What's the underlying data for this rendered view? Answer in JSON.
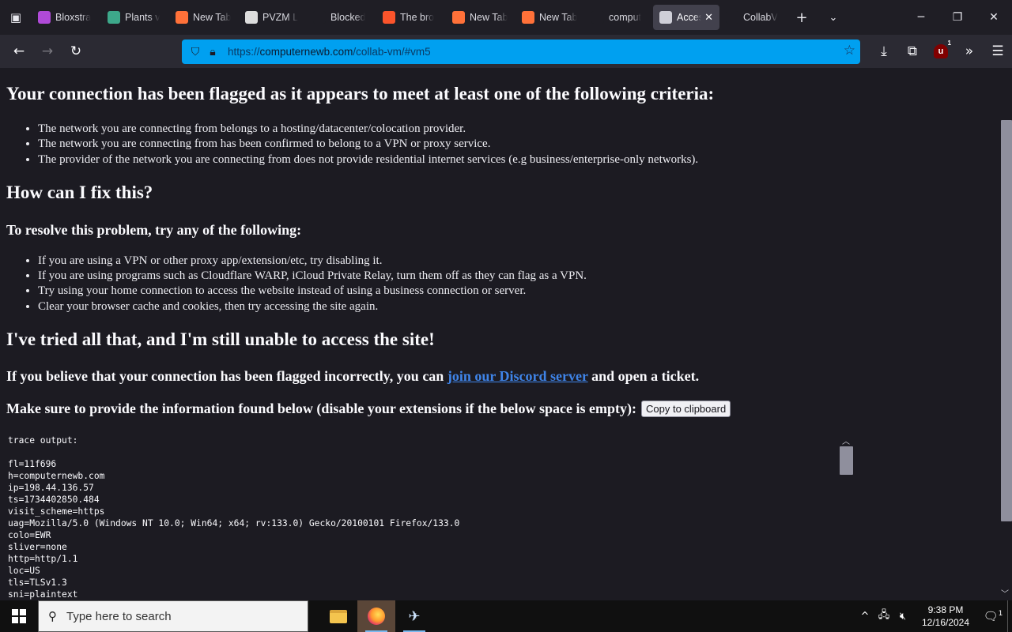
{
  "browser": {
    "tabs": [
      {
        "label": "Bloxstra",
        "icon": "bloxstrap-icon",
        "color": "#b04ad8"
      },
      {
        "label": "Plants v",
        "icon": "plants-icon",
        "color": "#3da88a"
      },
      {
        "label": "New Tab",
        "icon": "firefox-icon",
        "color": "#ff7139"
      },
      {
        "label": "PVZM L",
        "icon": "pvzm-icon",
        "color": "#dddddd"
      },
      {
        "label": "Blocked",
        "icon": "blank-icon",
        "color": "#1f1e25"
      },
      {
        "label": "The bro",
        "icon": "brave-icon",
        "color": "#fb542b"
      },
      {
        "label": "New Tab",
        "icon": "firefox-icon",
        "color": "#ff7139"
      },
      {
        "label": "New Tab",
        "icon": "firefox-icon",
        "color": "#ff7139"
      },
      {
        "label": "comput",
        "icon": "r-icon",
        "color": "#1f1e25"
      },
      {
        "label": "Acces",
        "icon": "collab-icon",
        "color": "#cfcfd8"
      },
      {
        "label": "CollabV",
        "icon": "search-icon",
        "color": "#1f1e25"
      }
    ],
    "url": {
      "scheme": "https://",
      "host": "computernewb.com",
      "path": "/collab-vm/#vm5"
    },
    "ublock_count": "1"
  },
  "page": {
    "headline": "Your connection has been flagged as it appears to meet at least one of the following criteria:",
    "criteria": [
      "The network you are connecting from belongs to a hosting/datacenter/colocation provider.",
      "The network you are connecting from has been confirmed to belong to a VPN or proxy service.",
      "The provider of the network you are connecting from does not provide residential internet services (e.g business/enterprise-only networks)."
    ],
    "fix_heading": "How can I fix this?",
    "resolve_heading": "To resolve this problem, try any of the following:",
    "fixes": [
      "If you are using a VPN or other proxy app/extension/etc, try disabling it.",
      "If you are using programs such as Cloudflare WARP, iCloud Private Relay, turn them off as they can flag as a VPN.",
      "Try using your home connection to access the website instead of using a business connection or server.",
      "Clear your browser cache and cookies, then try accessing the site again."
    ],
    "tried_heading": "I've tried all that, and I'm still unable to access the site!",
    "discord_before": "If you believe that your connection has been flagged incorrectly, you can ",
    "discord_link": "join our Discord server",
    "discord_after": " and open a ticket.",
    "provide_text": "Make sure to provide the information found below (disable your extensions if the below space is empty):",
    "copy_button": "Copy to clipboard",
    "trace_lines": [
      "trace output:",
      "",
      "fl=11f696",
      "h=computernewb.com",
      "ip=198.44.136.57",
      "ts=1734402850.484",
      "visit_scheme=https",
      "uag=Mozilla/5.0 (Windows NT 10.0; Win64; x64; rv:133.0) Gecko/20100101 Firefox/133.0",
      "colo=EWR",
      "sliver=none",
      "http=http/1.1",
      "loc=US",
      "tls=TLSv1.3",
      "sni=plaintext"
    ]
  },
  "taskbar": {
    "search_placeholder": "Type here to search",
    "time": "9:38 PM",
    "date": "12/16/2024",
    "notification_count": "1"
  }
}
